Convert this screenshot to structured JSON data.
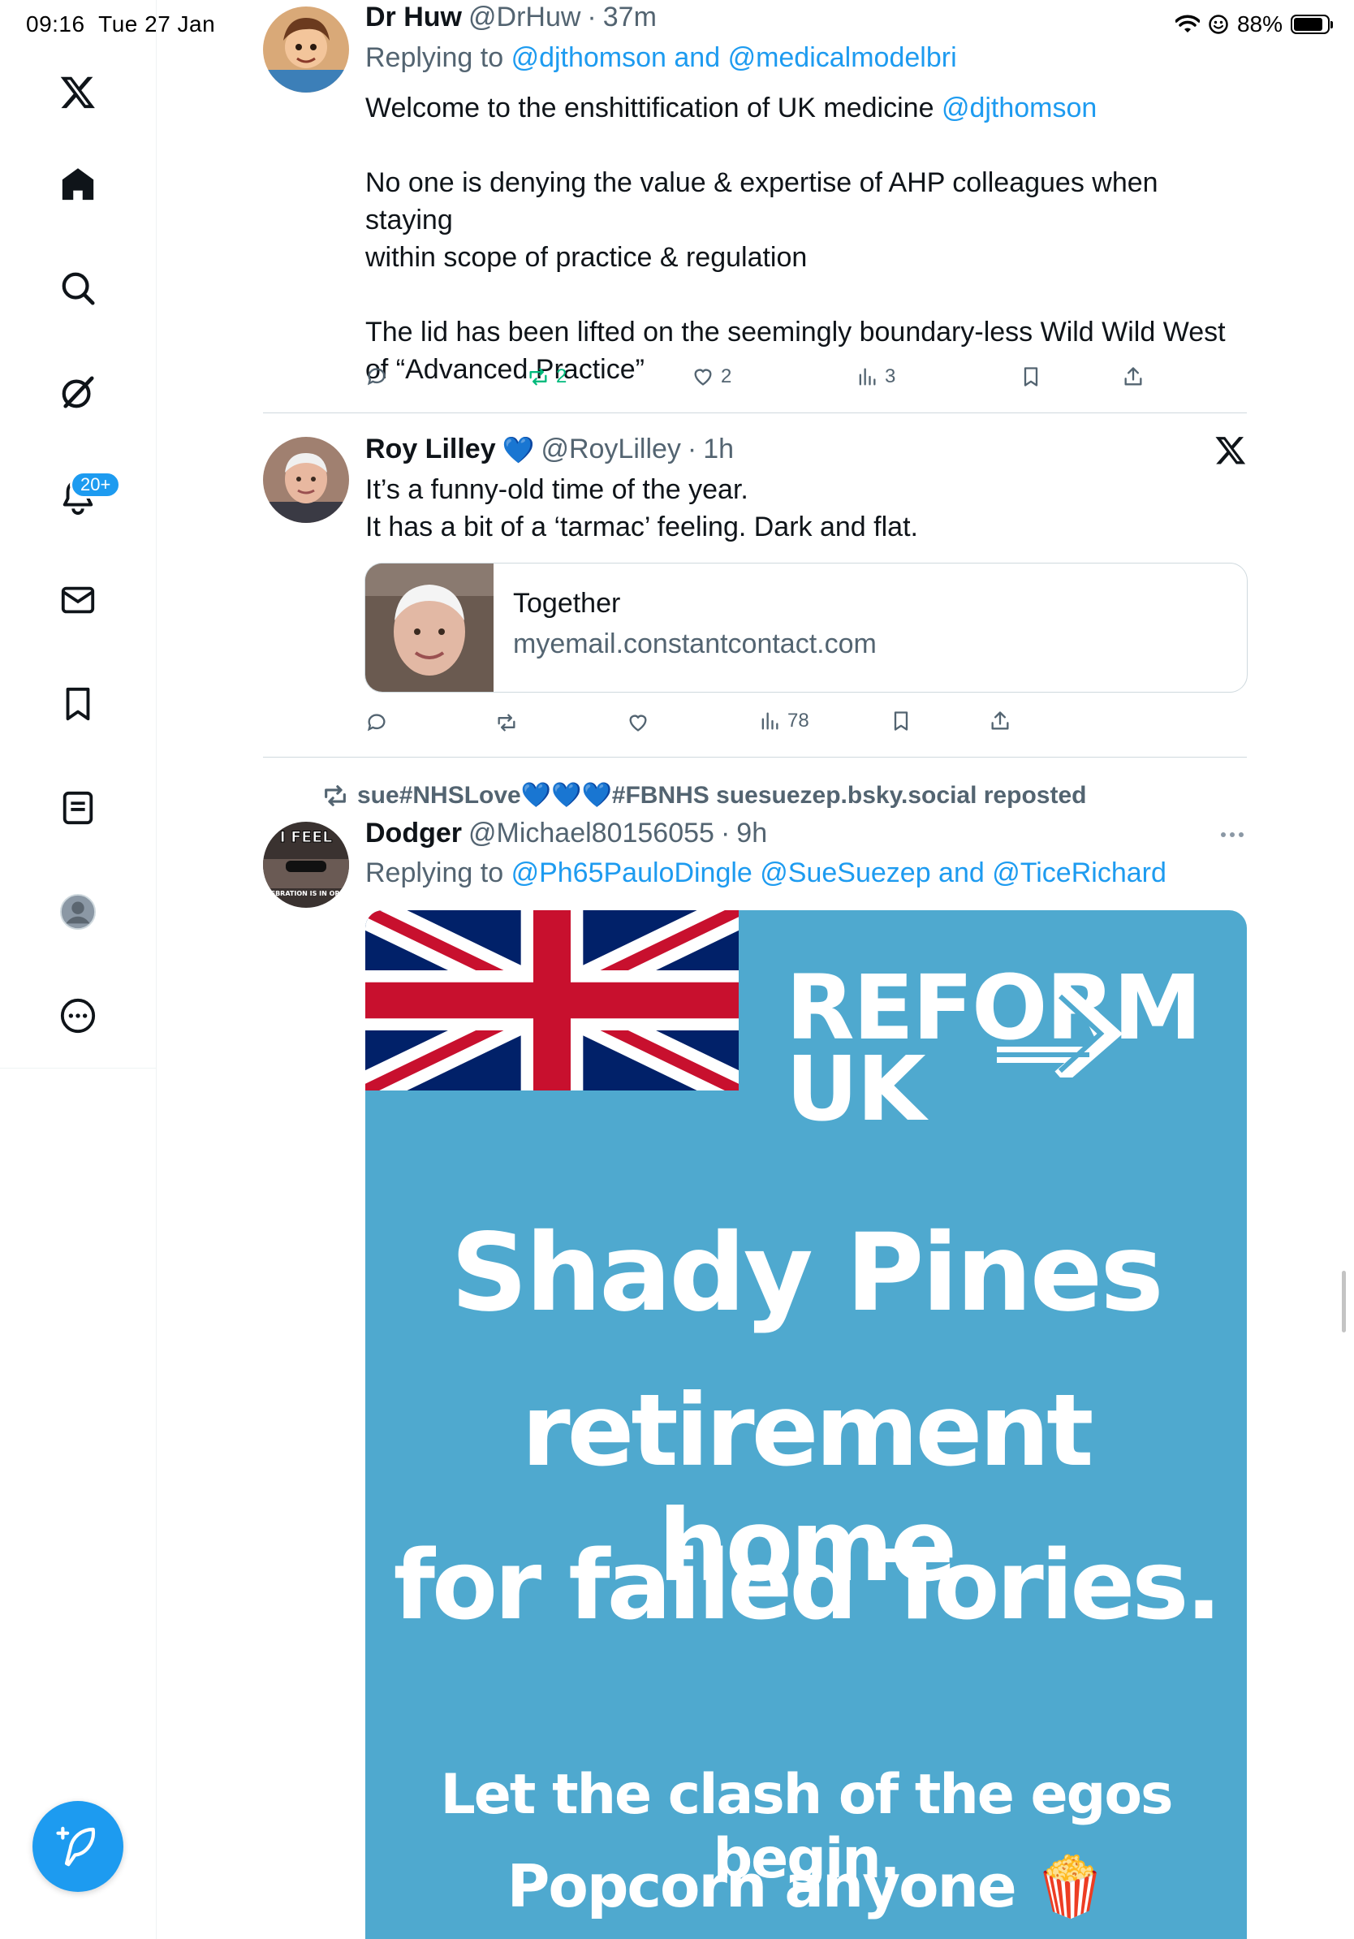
{
  "status_bar": {
    "time": "09:16",
    "date": "Tue 27 Jan",
    "battery": "88%",
    "battery_level": 0.88
  },
  "sidebar": {
    "items": [
      {
        "icon": "x-logo-icon"
      },
      {
        "icon": "home-icon"
      },
      {
        "icon": "search-icon"
      },
      {
        "icon": "grok-icon"
      },
      {
        "icon": "notifications-icon"
      },
      {
        "icon": "messages-icon"
      },
      {
        "icon": "bookmarks-icon"
      },
      {
        "icon": "lists-icon"
      },
      {
        "icon": "profile-icon"
      },
      {
        "icon": "more-icon"
      }
    ],
    "notifications_badge": "20+"
  },
  "tweets": [
    {
      "name": "Dr Huw",
      "handle": "@DrHuw",
      "sep": "·",
      "time": "37m",
      "reply_prefix": "Replying to",
      "reply_mentions": "@djthomson and @medicalmodelbri",
      "body_1": "Welcome to the enshittification of UK medicine ",
      "body_1_mention": "@djthomson",
      "body_2a": "No one is denying the value & expertise of AHP colleagues when staying",
      "body_2b": "within scope of practice & regulation",
      "body_3a": "The lid has been lifted on the seemingly boundary-less  Wild Wild West",
      "body_3b": "of “Advanced Practice”",
      "replies": "",
      "reposts": "2",
      "likes": "2",
      "views": "3"
    },
    {
      "name": "Roy Lilley",
      "badge": "💙",
      "handle": "@RoyLilley",
      "sep": "·",
      "time": "1h",
      "body_1": "It’s a funny-old time of the year.",
      "body_2": "It has a bit of a ‘tarmac’ feeling. Dark and flat.",
      "card_title": "Together",
      "card_domain": "myemail.constantcontact.com",
      "replies": "",
      "reposts": "",
      "likes": "",
      "views": "78"
    },
    {
      "repost_by": "sue#NHSLove💙💙💙#FBNHS suesuezep.bsky.social reposted",
      "name": "Dodger",
      "handle": "@Michael80156055",
      "sep": "·",
      "time": "9h",
      "reply_prefix": "Replying to",
      "reply_mentions": "@Ph65PauloDingle @SueSuezep and @TiceRichard",
      "avatar_text_top": "I FEEL",
      "avatar_text_bottom": "CELEBRATION IS IN ORDER",
      "media": {
        "logo_line1": "REFORM",
        "logo_line2": "UK",
        "line1": "Shady Pines",
        "line2": "retirement home",
        "line3": "for failed Tories.",
        "line4": "Let the clash of the egos begin.",
        "line5": "Popcorn anyone 🍿"
      }
    }
  ],
  "colors": {
    "accent": "#1d9bf0",
    "repost_green": "#00ba7c",
    "muted": "#536471",
    "poster_blue": "#4fa9cf"
  }
}
